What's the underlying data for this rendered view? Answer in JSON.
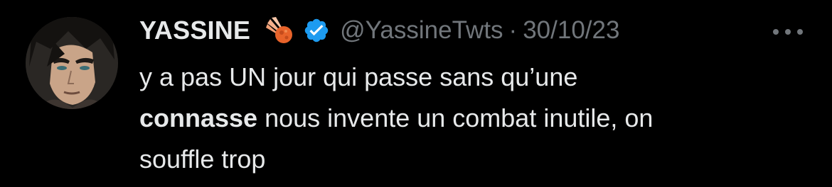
{
  "tweet": {
    "author_name": "YASSINE",
    "name_emoji": "meteor-emoji",
    "verified_badge": "verified-badge-icon",
    "handle": "@YassineTwts",
    "separator": "·",
    "date": "30/10/23",
    "more_icon": "more-options-icon",
    "text": {
      "line1": "y a pas UN jour qui passe sans qu’une",
      "line2_bold": "connasse",
      "line2_rest": " nous invente un combat inutile, on",
      "line3": "souffle trop"
    }
  },
  "colors": {
    "background": "#000000",
    "primary_text": "#e7e9ea",
    "secondary_text": "#71767b",
    "verified_blue": "#1d9bf0"
  }
}
